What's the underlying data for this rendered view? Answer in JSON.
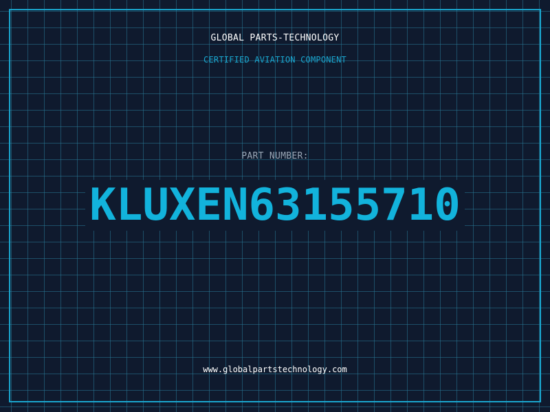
{
  "header": {
    "company_name": "GLOBAL PARTS-TECHNOLOGY",
    "tagline": "CERTIFIED AVIATION COMPONENT"
  },
  "part": {
    "label": "PART NUMBER:",
    "number": "KLUXEN63155710"
  },
  "footer": {
    "website": "www.globalpartstechnology.com"
  },
  "colors": {
    "background": "#0f1a2e",
    "accent": "#12b3dc",
    "grid": "#287896",
    "label": "#9aa7b6",
    "text": "#ffffff"
  }
}
